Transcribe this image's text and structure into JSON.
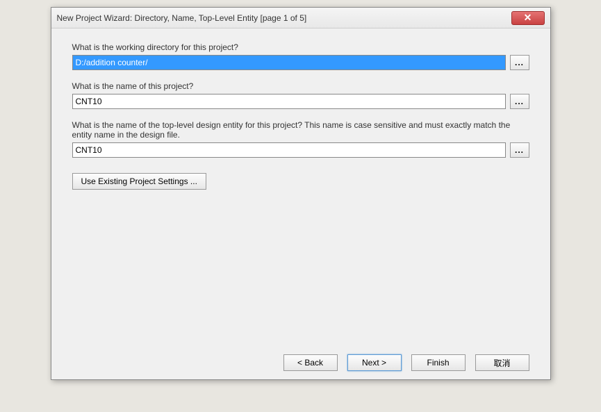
{
  "window": {
    "title": "New Project Wizard: Directory, Name, Top-Level Entity [page 1 of 5]"
  },
  "fields": {
    "directory": {
      "label": "What is the working directory for this project?",
      "value": "D:/addition counter/"
    },
    "projectName": {
      "label": "What is the name of this project?",
      "value": "CNT10"
    },
    "topLevelEntity": {
      "label": "What is the name of the top-level design entity for this project? This name is case sensitive and must exactly match the entity name in the design file.",
      "value": "CNT10"
    }
  },
  "buttons": {
    "browse": "...",
    "existing": "Use Existing Project Settings ...",
    "back": "< Back",
    "next": "Next >",
    "finish": "Finish",
    "cancel": "取消"
  }
}
